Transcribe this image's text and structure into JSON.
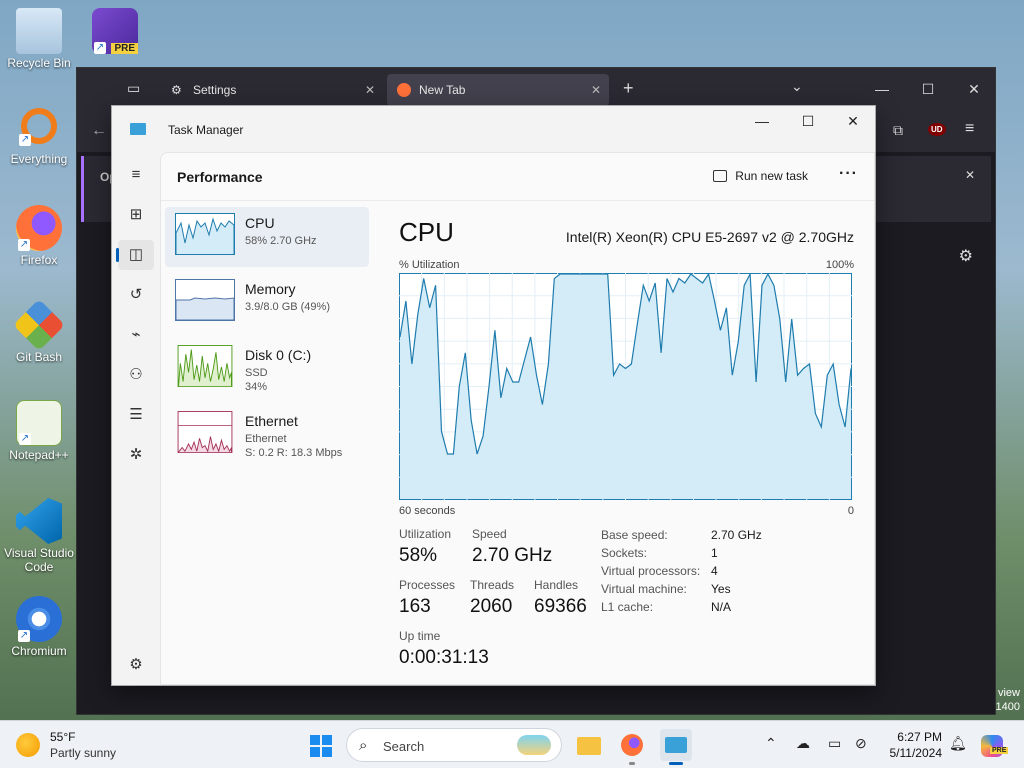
{
  "desktop": {
    "icons": [
      {
        "label": "Recycle Bin"
      },
      {
        "label": "Everything"
      },
      {
        "label": "Firefox"
      },
      {
        "label": "Git Bash"
      },
      {
        "label": "Notepad++"
      },
      {
        "label": "Visual Studio Code"
      },
      {
        "label": "Chromium"
      }
    ],
    "vs_badge": "PRE",
    "corner_text": [
      "view",
      "1400"
    ]
  },
  "browser": {
    "tabs": [
      {
        "label": "Settings"
      },
      {
        "label": "New Tab"
      }
    ],
    "notice_text": "Op",
    "extension_badge": "UD"
  },
  "task_manager": {
    "title": "Task Manager",
    "header": {
      "title": "Performance",
      "run_new_task": "Run new task",
      "more": "···"
    },
    "items": [
      {
        "name": "CPU",
        "sub1": "58% 2.70 GHz",
        "sub2": ""
      },
      {
        "name": "Memory",
        "sub1": "3.9/8.0 GB (49%)",
        "sub2": ""
      },
      {
        "name": "Disk 0 (C:)",
        "sub1": "SSD",
        "sub2": "34%"
      },
      {
        "name": "Ethernet",
        "sub1": "Ethernet",
        "sub2": "S: 0.2  R: 18.3 Mbps"
      }
    ],
    "detail": {
      "heading": "CPU",
      "model": "Intel(R) Xeon(R) CPU E5-2697 v2 @ 2.70GHz",
      "util_label": "% Utilization",
      "util_max": "100%",
      "time_label": "60 seconds",
      "time_zero": "0",
      "stats": {
        "utilization_label": "Utilization",
        "utilization": "58%",
        "speed_label": "Speed",
        "speed": "2.70 GHz",
        "processes_label": "Processes",
        "processes": "163",
        "threads_label": "Threads",
        "threads": "2060",
        "handles_label": "Handles",
        "handles": "69366",
        "uptime_label": "Up time",
        "uptime": "0:00:31:13"
      },
      "specs": [
        {
          "k": "Base speed:",
          "v": "2.70 GHz"
        },
        {
          "k": "Sockets:",
          "v": "1"
        },
        {
          "k": "Virtual processors:",
          "v": "4"
        },
        {
          "k": "Virtual machine:",
          "v": "Yes"
        },
        {
          "k": "L1 cache:",
          "v": "N/A"
        }
      ]
    },
    "cpu_history": [
      72,
      88,
      60,
      82,
      98,
      85,
      95,
      30,
      20,
      20,
      50,
      65,
      35,
      20,
      28,
      50,
      75,
      45,
      58,
      52,
      52,
      62,
      72,
      55,
      42,
      60,
      98,
      100,
      100,
      100,
      100,
      100,
      100,
      100,
      100,
      100,
      55,
      60,
      58,
      60,
      78,
      95,
      88,
      96,
      65,
      98,
      92,
      98,
      96,
      100,
      98,
      96,
      100,
      88,
      75,
      85,
      55,
      70,
      95,
      100,
      52,
      95,
      100,
      95,
      80,
      52,
      80,
      55,
      58,
      60,
      38,
      32,
      55,
      60,
      42,
      32,
      58
    ]
  },
  "taskbar": {
    "weather_temp": "55°F",
    "weather_cond": "Partly sunny",
    "search_placeholder": "Search",
    "time": "6:27 PM",
    "date": "5/11/2024",
    "copilot_badge": "PRE"
  },
  "colors": {
    "accent": "#005fb8",
    "cpu_line": "#1f7cae",
    "cpu_fill": "#d3ecf7",
    "memory_line": "#4f74a6",
    "disk_line": "#4d9a16",
    "ethernet_line": "#a33057"
  }
}
